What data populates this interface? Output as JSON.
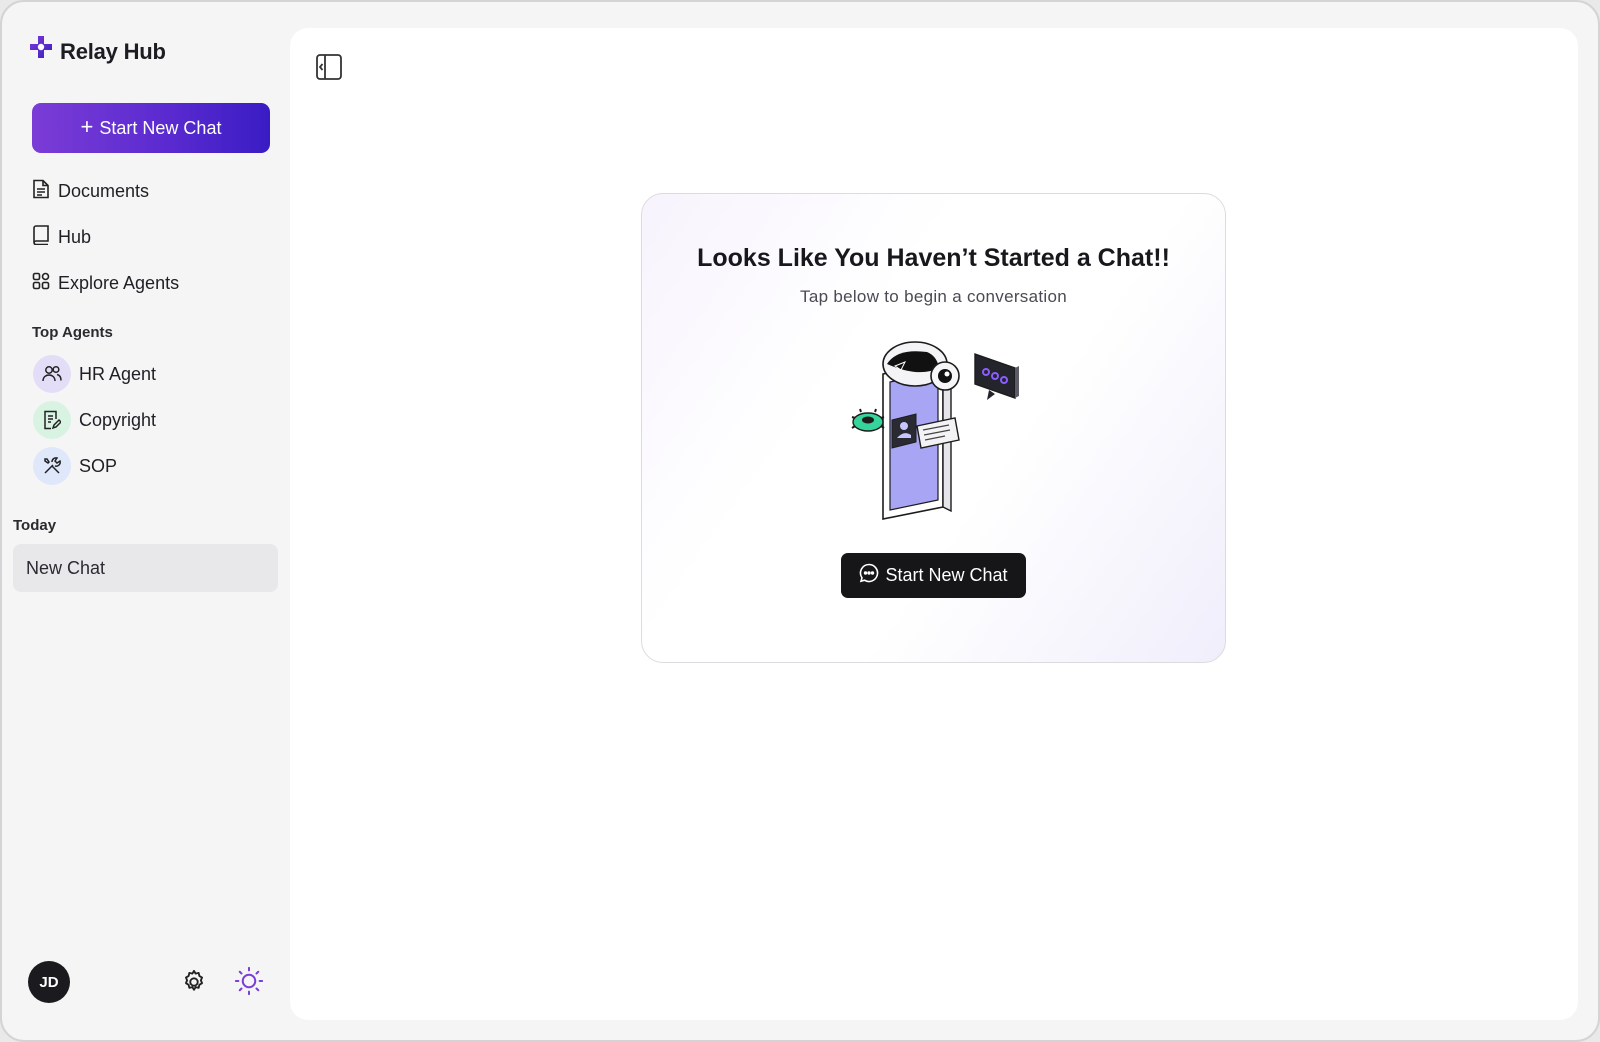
{
  "brand": {
    "name": "Relay Hub",
    "logo_icon": "relay-cross-logo",
    "accent": "#5b2bd0"
  },
  "sidebar": {
    "start_button": {
      "label": "Start New Chat",
      "icon": "plus-icon"
    },
    "nav": [
      {
        "label": "Documents",
        "icon": "document-icon"
      },
      {
        "label": "Hub",
        "icon": "book-icon"
      },
      {
        "label": "Explore Agents",
        "icon": "grid-icon"
      }
    ],
    "top_agents_label": "Top Agents",
    "agents": [
      {
        "label": "HR Agent",
        "icon": "users-icon",
        "bg": "#e4ddf7"
      },
      {
        "label": "Copyright",
        "icon": "document-edit-icon",
        "bg": "#d9f3e3"
      },
      {
        "label": "SOP",
        "icon": "tools-icon",
        "bg": "#dfe7fb"
      }
    ],
    "history_label": "Today",
    "history": [
      {
        "label": "New Chat"
      }
    ],
    "footer": {
      "user_initials": "JD",
      "settings_icon": "gear-icon",
      "theme_icon": "sun-icon"
    }
  },
  "main": {
    "toggle_icon": "sidebar-toggle-icon",
    "empty_state": {
      "title": "Looks Like You Haven’t Started a Chat!!",
      "subtitle": "Tap below to begin a conversation",
      "button_label": "Start New Chat",
      "button_icon": "chat-bubble-icon"
    }
  }
}
